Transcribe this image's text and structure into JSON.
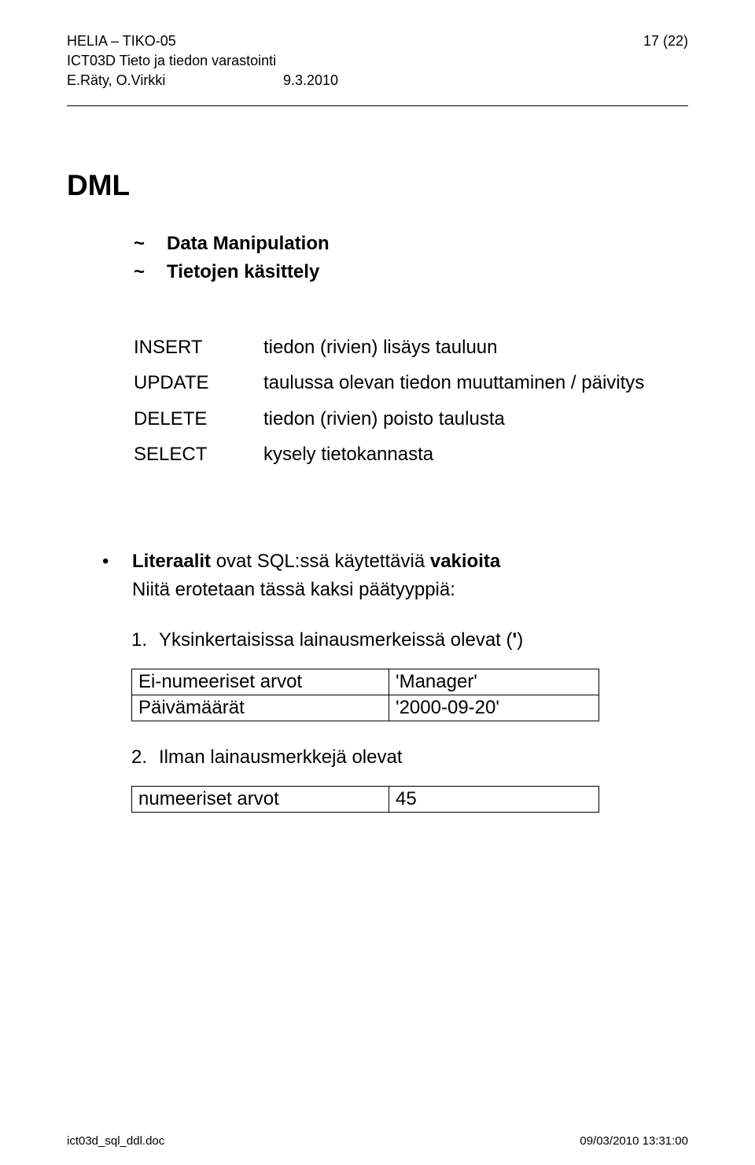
{
  "header": {
    "line1_left": "HELIA – TIKO-05",
    "line1_right": "17 (22)",
    "line2_left": "ICT03D Tieto ja tiedon varastointi",
    "line3_author": "E.Räty, O.Virkki",
    "line3_date": "9.3.2010"
  },
  "main": {
    "title": "DML",
    "tilde": [
      "Data Manipulation",
      "Tietojen käsittely"
    ],
    "commands": [
      {
        "cmd": "INSERT",
        "desc": "tiedon (rivien) lisäys tauluun"
      },
      {
        "cmd": "UPDATE",
        "desc": "taulussa olevan tiedon muuttaminen / päivitys"
      },
      {
        "cmd": "DELETE",
        "desc": "tiedon (rivien) poisto taulusta"
      },
      {
        "cmd": "SELECT",
        "desc": "kysely tietokannasta"
      }
    ],
    "bullet": {
      "bold1": "Literaalit",
      "mid": " ovat SQL:ssä käytettäviä ",
      "bold2": "vakioita",
      "line2": "Niitä erotetaan tässä kaksi päätyyppiä:"
    },
    "item1": {
      "num": "1.",
      "text_before": "Yksinkertaisissa lainausmerkeissä olevat (",
      "quote": "'",
      "text_after": ")",
      "table": [
        {
          "c1": "Ei-numeeriset arvot",
          "c2": "'Manager'"
        },
        {
          "c1": "Päivämäärät",
          "c2": "'2000-09-20'"
        }
      ]
    },
    "item2": {
      "num": "2.",
      "text": "Ilman lainausmerkkejä olevat",
      "table": [
        {
          "c1": "numeeriset arvot",
          "c2": "45"
        }
      ]
    }
  },
  "footer": {
    "left": "ict03d_sql_ddl.doc",
    "right": "09/03/2010 13:31:00"
  }
}
